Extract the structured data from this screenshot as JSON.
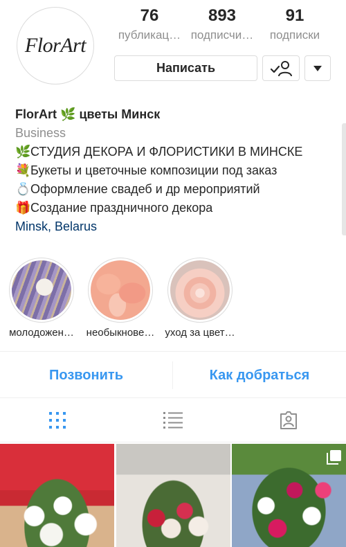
{
  "profile": {
    "avatar_logo": "FlorArt",
    "stats": [
      {
        "value": "76",
        "label": "публикац…"
      },
      {
        "value": "893",
        "label": "подписчи…"
      },
      {
        "value": "91",
        "label": "подписки"
      }
    ],
    "message_button": "Написать",
    "follow_icon": "person-check-icon",
    "more_icon": "triangle-down-icon"
  },
  "bio": {
    "name": "FlorArt",
    "name_emoji": "🌿",
    "name_suffix": "цветы Минск",
    "category": "Business",
    "lines": [
      {
        "emoji": "🌿",
        "text": "СТУДИЯ ДЕКОРА И ФЛОРИСТИКИ В МИНСКЕ"
      },
      {
        "emoji": "💐",
        "text": "Букеты и цветочные композиции под заказ"
      },
      {
        "emoji": "💍",
        "text": "Оформление свадеб и др мероприятий"
      },
      {
        "emoji": "🎁",
        "text": "Создание праздничного декора"
      }
    ],
    "location": "Minsk, Belarus"
  },
  "highlights": [
    {
      "caption": "молодожен…"
    },
    {
      "caption": "необыкнове…"
    },
    {
      "caption": "уход за цвет…"
    }
  ],
  "actions": {
    "call": "Позвонить",
    "directions": "Как добраться"
  },
  "tabs": [
    {
      "name": "grid",
      "icon": "grid-icon",
      "active": true
    },
    {
      "name": "feed",
      "icon": "list-icon",
      "active": false
    },
    {
      "name": "tagged",
      "icon": "tagged-photo-icon",
      "active": false
    }
  ],
  "colors": {
    "accent": "#3897f0",
    "muted": "#8e8e8e",
    "location": "#003569"
  }
}
